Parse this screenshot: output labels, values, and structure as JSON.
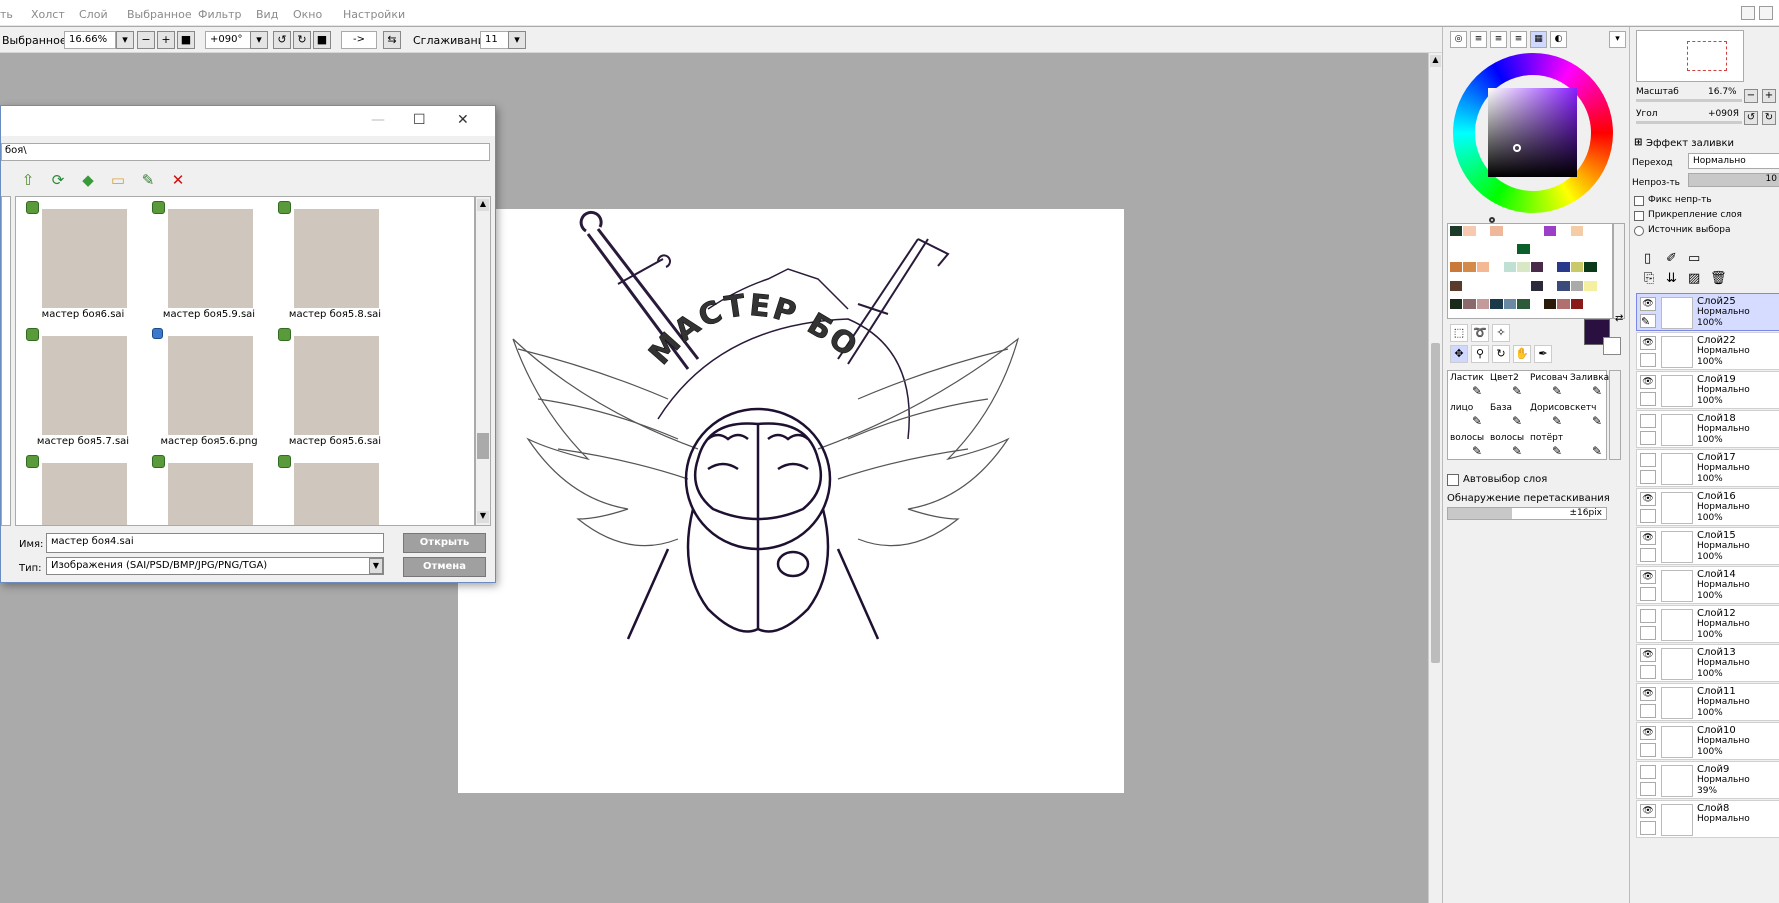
{
  "menu": [
    "ть",
    "Холст",
    "Слой",
    "Выбранное",
    "Фильтр",
    "Вид",
    "Окно",
    "Настройки"
  ],
  "toolbar": {
    "selected_label": "Выбранное",
    "zoom": "16.66%",
    "angle": "+090°",
    "arrow": "->",
    "smoothing_label": "Сглаживание",
    "smoothing": "11"
  },
  "dialog": {
    "path": "боя\\",
    "files": [
      {
        "name": "мастер боя6.sai",
        "badge": "sai"
      },
      {
        "name": "мастер боя5.9.sai",
        "badge": "sai"
      },
      {
        "name": "мастер боя5.8.sai",
        "badge": "sai"
      },
      {
        "name": "мастер боя5.7.sai",
        "badge": "sai"
      },
      {
        "name": "мастер боя5.6.png",
        "badge": "png"
      },
      {
        "name": "мастер боя5.6.sai",
        "badge": "sai"
      },
      {
        "name": "",
        "badge": "sai"
      },
      {
        "name": "",
        "badge": "sai"
      },
      {
        "name": "",
        "badge": "sai"
      }
    ],
    "name_label": "Имя:",
    "name_value": "мастер боя4.sai",
    "type_label": "Тип:",
    "type_value": "Изображения (SAI/PSD/BMP/JPG/PNG/TGA)",
    "open_button": "Открыть",
    "cancel_button": "Отмена"
  },
  "canvas": {
    "arc_text": "МАСТЕР БОЯ"
  },
  "colors": {
    "primary": "#2a1040",
    "accent": "#8820ff",
    "selected_layer": "#d6dcff"
  },
  "swatches": [
    "#1b3a2a",
    "#f6c9b0",
    "#ffffff",
    "#f0b89a",
    "#ffffff",
    "#ffffff",
    "#ffffff",
    "#9b3fc9",
    "#ffffff",
    "#f4cda7",
    "#ffffff",
    "#ffffff",
    "#ffffff",
    "#ffffff",
    "#ffffff",
    "#ffffff",
    "#ffffff",
    "#0a5f2a",
    "#ffffff",
    "#ffffff",
    "#ffffff",
    "#ffffff",
    "#ffffff",
    "#ffffff",
    "#c97a3b",
    "#d48b4a",
    "#f3b894",
    "#ffffff",
    "#bfe0d2",
    "#d8e8c4",
    "#4a2a4a",
    "#ffffff",
    "#2a3a8a",
    "#c9c96a",
    "#0a3a1a",
    "#ffffff",
    "#5a3a2a",
    "#ffffff",
    "#ffffff",
    "#ffffff",
    "#ffffff",
    "#ffffff",
    "#2a2a3a",
    "#ffffff",
    "#3a4a7a",
    "#aaaaaa",
    "#f4f0a0",
    "#ffffff",
    "#1a2a1a",
    "#8a6a6a",
    "#c49a9a",
    "#1a3a4a",
    "#6a8aa4",
    "#2a5a3a",
    "#ffffff",
    "#2a1a0a",
    "#b07070",
    "#8a1a1a",
    "#ffffff",
    "#ffffff"
  ],
  "brushes": [
    {
      "label": "Ластик"
    },
    {
      "label": "Цвет2"
    },
    {
      "label": "Рисовач"
    },
    {
      "label": "Заливка"
    },
    {
      "label": "лицо"
    },
    {
      "label": "База"
    },
    {
      "label": "Дорисов"
    },
    {
      "label": "скетч"
    },
    {
      "label": "волосы"
    },
    {
      "label": "волосы"
    },
    {
      "label": "потёрт"
    },
    {
      "label": ""
    }
  ],
  "tool_options": {
    "auto_select": "Автовыбор слоя",
    "drag_detect": "Обнаружение перетаскивания",
    "drag_value": "±16pix"
  },
  "navigator": {
    "scale_label": "Масштаб",
    "scale": "16.7%",
    "angle_label": "Угол",
    "angle": "+090Я"
  },
  "layer_props": {
    "fill_effect": "Эффект заливки",
    "blend_label": "Переход",
    "blend_value": "Нормально",
    "opacity_label": "Непроз-ть",
    "opacity_value": "10",
    "fix_opacity": "Фикс непр-ть",
    "clip_layer": "Прикрепление слоя",
    "selection_source": "Источник выбора"
  },
  "layers": [
    {
      "name": "Слой25",
      "mode": "Нормально",
      "opacity": "100%",
      "visible": true,
      "selected": true
    },
    {
      "name": "Слой22",
      "mode": "Нормально",
      "opacity": "100%",
      "visible": true,
      "selected": false
    },
    {
      "name": "Слой19",
      "mode": "Нормально",
      "opacity": "100%",
      "visible": true,
      "selected": false
    },
    {
      "name": "Слой18",
      "mode": "Нормально",
      "opacity": "100%",
      "visible": false,
      "selected": false
    },
    {
      "name": "Слой17",
      "mode": "Нормально",
      "opacity": "100%",
      "visible": false,
      "selected": false
    },
    {
      "name": "Слой16",
      "mode": "Нормально",
      "opacity": "100%",
      "visible": true,
      "selected": false
    },
    {
      "name": "Слой15",
      "mode": "Нормально",
      "opacity": "100%",
      "visible": true,
      "selected": false
    },
    {
      "name": "Слой14",
      "mode": "Нормально",
      "opacity": "100%",
      "visible": true,
      "selected": false
    },
    {
      "name": "Слой12",
      "mode": "Нормально",
      "opacity": "100%",
      "visible": false,
      "selected": false
    },
    {
      "name": "Слой13",
      "mode": "Нормально",
      "opacity": "100%",
      "visible": true,
      "selected": false
    },
    {
      "name": "Слой11",
      "mode": "Нормально",
      "opacity": "100%",
      "visible": true,
      "selected": false
    },
    {
      "name": "Слой10",
      "mode": "Нормально",
      "opacity": "100%",
      "visible": true,
      "selected": false
    },
    {
      "name": "Слой9",
      "mode": "Нормально",
      "opacity": "39%",
      "visible": false,
      "selected": false
    },
    {
      "name": "Слой8",
      "mode": "Нормально",
      "opacity": "",
      "visible": true,
      "selected": false
    }
  ]
}
